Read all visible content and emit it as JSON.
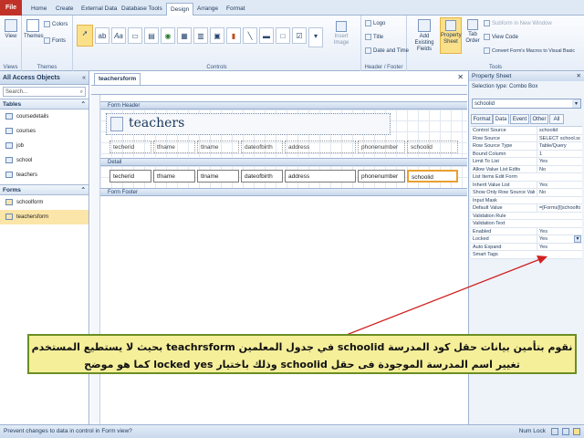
{
  "ribbon": {
    "file": "File",
    "tabs": [
      "Home",
      "Create",
      "External Data",
      "Database Tools",
      "Design",
      "Arrange",
      "Format"
    ],
    "views": {
      "label": "View",
      "group": "Views"
    },
    "themes": {
      "themes": "Themes",
      "colors": "Colors",
      "fonts": "Fonts",
      "group": "Themes"
    },
    "controls": {
      "group": "Controls",
      "insert_image": "Insert Image"
    },
    "header_footer": {
      "logo": "Logo",
      "title": "Title",
      "date_time": "Date and Time",
      "group": "Header / Footer"
    },
    "tools": {
      "add_fields": "Add Existing Fields",
      "property_sheet": "Property Sheet",
      "tab_order": "Tab Order",
      "subform": "Subform in New Window",
      "view_code": "View Code",
      "convert": "Convert Form's Macros to Visual Basic",
      "group": "Tools"
    }
  },
  "nav": {
    "title": "All Access Objects",
    "search_placeholder": "Search...",
    "tables_header": "Tables",
    "tables": [
      "coursedetails",
      "courses",
      "job",
      "school",
      "teachers"
    ],
    "forms_header": "Forms",
    "forms": [
      "schoolform",
      "teachersform"
    ]
  },
  "doc": {
    "tab": "teachersform",
    "form_header": "Form Header",
    "detail": "Detail",
    "form_footer": "Form Footer",
    "title": "teachers",
    "header_labels": [
      "techerid",
      "tfname",
      "tlname",
      "dateofbirth",
      "address",
      "phonenumber",
      "schoolid"
    ],
    "fields": [
      "techerid",
      "tfname",
      "tlname",
      "dateofbirth",
      "address",
      "phonenumber",
      "schoolid"
    ]
  },
  "property_sheet": {
    "title": "Property Sheet",
    "selection_type": "Selection type:  Combo Box",
    "selected": "schoolid",
    "tabs": [
      "Format",
      "Data",
      "Event",
      "Other",
      "All"
    ],
    "active_tab": "Data",
    "rows": [
      [
        "Control Source",
        "schoolid"
      ],
      [
        "Row Source",
        "SELECT school.scho"
      ],
      [
        "Row Source Type",
        "Table/Query"
      ],
      [
        "Bound Column",
        "1"
      ],
      [
        "Limit To List",
        "Yes"
      ],
      [
        "Allow Value List Edits",
        "No"
      ],
      [
        "List Items Edit Form",
        ""
      ],
      [
        "Inherit Value List",
        "Yes"
      ],
      [
        "Show Only Row Source Values",
        "No"
      ],
      [
        "Input Mask",
        ""
      ],
      [
        "Default Value",
        "=[Forms]![schoolfor"
      ],
      [
        "Validation Rule",
        ""
      ],
      [
        "Validation Text",
        ""
      ],
      [
        "Enabled",
        "Yes"
      ],
      [
        "Locked",
        "Yes"
      ],
      [
        "Auto Expand",
        "Yes"
      ],
      [
        "Smart Tags",
        ""
      ]
    ]
  },
  "callout": {
    "line1": "نقوم بتأمين بيانات حقل كود المدرسة schoolid في جدول المعلمين teachrsform بحيث لا يستطيع المستخدم",
    "line2": "تغيير اسم المدرسة الموجودة فى حقل schoolid وذلك باختيار locked yes كما هو موضح"
  },
  "status": {
    "left": "Prevent changes to data in control in Form view?",
    "right": "Num Lock"
  },
  "colors": {
    "file": "#c03228",
    "callout_bg": "#f5ef9a",
    "callout_border": "#6b8e23",
    "arrow": "#d02020",
    "selected": "#fbe5a8"
  }
}
